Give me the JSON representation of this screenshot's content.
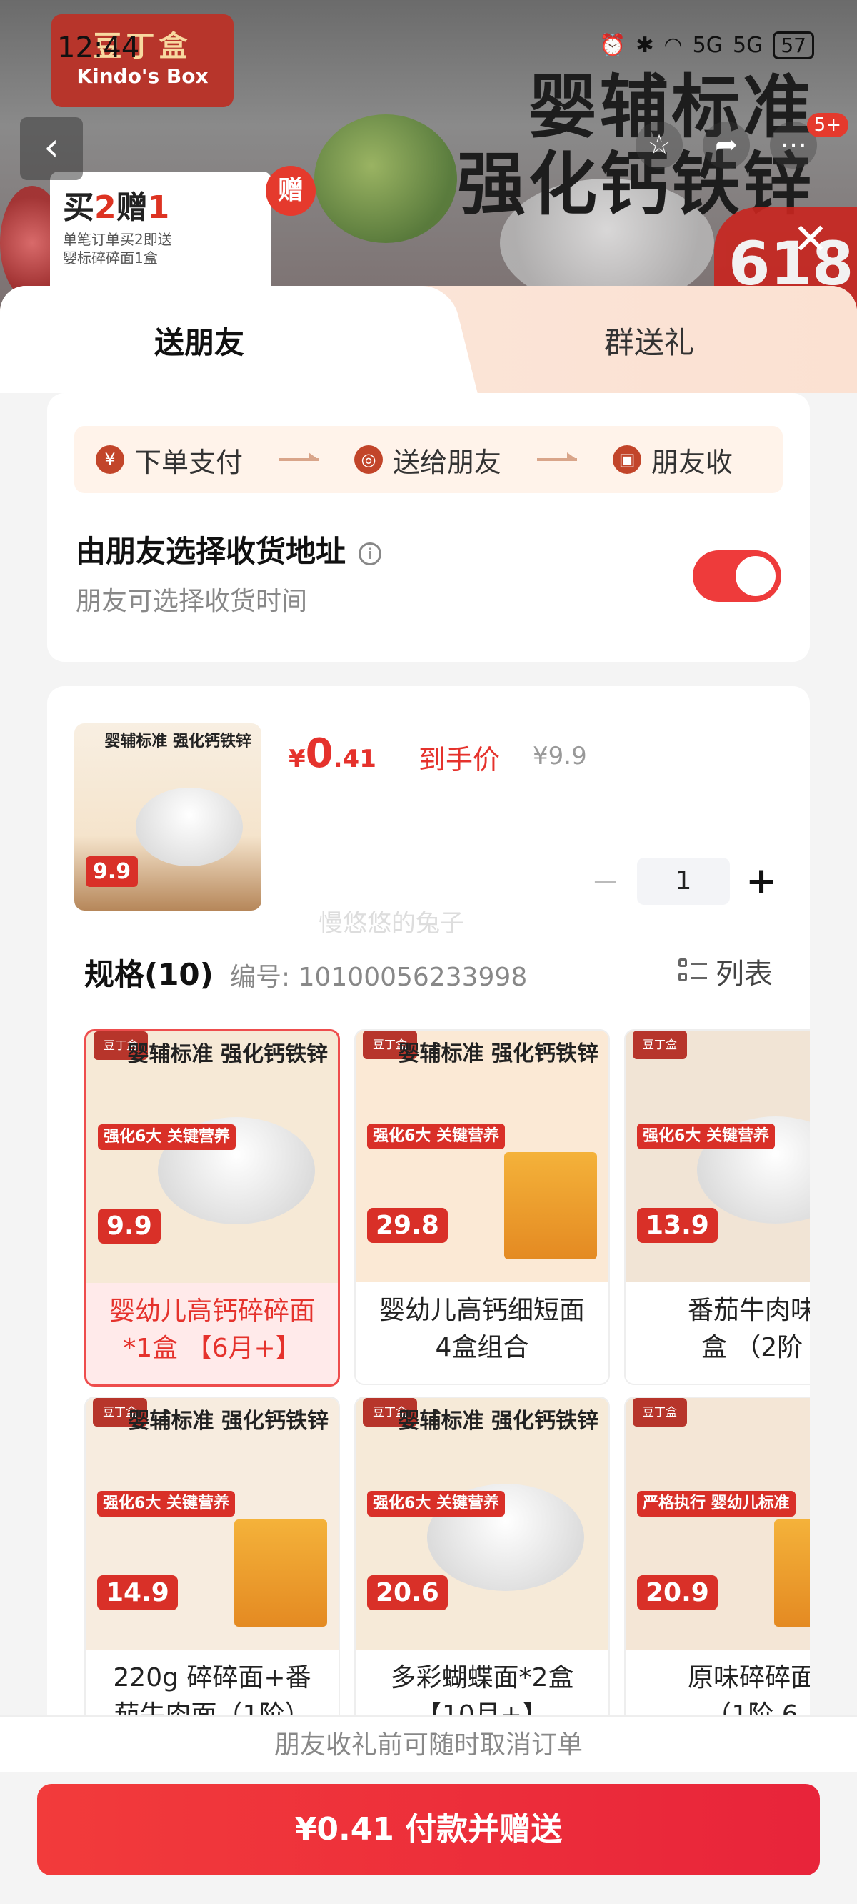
{
  "status_bar": {
    "time": "12:44",
    "network": "5G",
    "network2": "5G",
    "battery": "57"
  },
  "banner": {
    "brand_cn": "豆丁盒",
    "brand_en": "Kindo's Box",
    "headline1": "婴辅标准",
    "headline2": "强化钙铁锌",
    "promo_title_a": "买",
    "promo_title_num1": "2",
    "promo_title_b": "赠",
    "promo_title_num2": "1",
    "promo_sub": "单笔订单买2即送 婴标碎碎面1盒",
    "gift_badge": "赠",
    "badge_618": "618",
    "msg_count": "5+"
  },
  "tabs": [
    {
      "label": "送朋友",
      "active": true
    },
    {
      "label": "群送礼",
      "active": false
    }
  ],
  "flow_steps": [
    {
      "icon": "¥",
      "label": "下单支付"
    },
    {
      "icon": "◎",
      "label": "送给朋友"
    },
    {
      "icon": "▣",
      "label": "朋友收"
    }
  ],
  "address": {
    "title": "由朋友选择收货地址",
    "subtitle": "朋友可选择收货时间",
    "enabled": true
  },
  "product": {
    "thumb_headline": "婴辅标准 强化钙铁锌",
    "thumb_price": "9.9",
    "price_currency": "¥",
    "price_int": "0",
    "price_dec": ".41",
    "price_label": "到手价",
    "original_price": "¥9.9",
    "quantity": "1",
    "watermark": "慢悠悠的兔子"
  },
  "spec": {
    "title": "规格(10)",
    "code": "编号: 10100056233998",
    "view_toggle": "列表"
  },
  "options": [
    {
      "headline": "婴辅标准 强化钙铁锌",
      "badge": "强化6大 关键营养",
      "price": "9.9",
      "name1": "婴幼儿高钙碎碎面",
      "name2": "*1盒 【6月+】",
      "selected": true,
      "bg": "#f6e9d6"
    },
    {
      "headline": "婴辅标准 强化钙铁锌",
      "badge": "强化6大 关键营养",
      "price": "29.8",
      "name1": "婴幼儿高钙细短面",
      "name2": "4盒组合",
      "selected": false,
      "bg": "#fbe9d5"
    },
    {
      "headline": "强化",
      "badge": "强化6大 关键营养",
      "price": "13.9",
      "name1": "番茄牛肉味",
      "name2": "盒 （2阶",
      "selected": false,
      "bg": "#f1e4d5"
    },
    {
      "headline": "婴辅标准 强化钙铁锌",
      "badge": "强化6大 关键营养",
      "price": "14.9",
      "name1": "220g 碎碎面+番",
      "name2": "茄牛肉面（1阶）",
      "selected": false,
      "bg": "#f7ecdf"
    },
    {
      "headline": "婴辅标准 强化钙铁锌",
      "badge": "强化6大 关键营养",
      "price": "20.6",
      "name1": "多彩蝴蝶面*2盒",
      "name2": "【10月+】",
      "selected": false,
      "bg": "#f6ead8"
    },
    {
      "headline": "强 营",
      "badge": "严格执行 婴幼儿标准",
      "price": "20.9",
      "name1": "原味碎碎面",
      "name2": "（1阶 6",
      "selected": false,
      "bg": "#f4e6d6"
    }
  ],
  "footer": {
    "notice": "朋友收礼前可随时取消订单",
    "pay_button": "¥0.41 付款并赠送"
  },
  "colors": {
    "accent": "#e5322c",
    "toggle": "#ee3b3b",
    "step_bg": "#fff3ea"
  }
}
